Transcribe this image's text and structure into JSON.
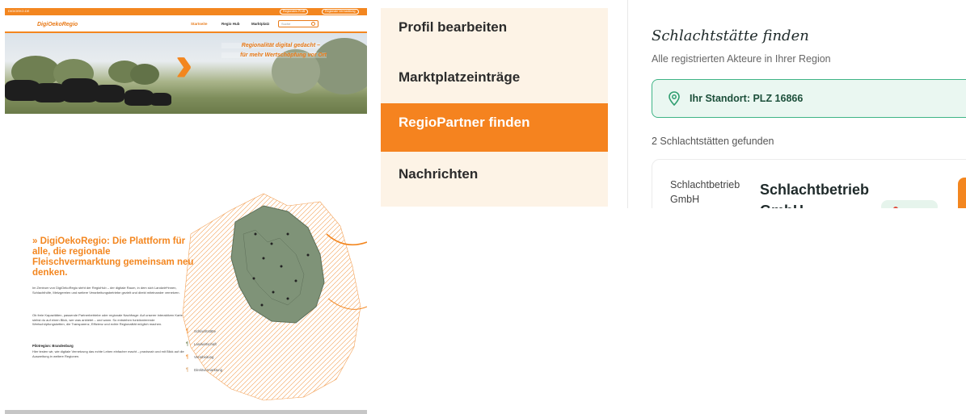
{
  "website": {
    "topbar": {
      "left_text": "DIGIOEKO.DE",
      "login_label": "Regionales Profil",
      "register_label": "Regionale Vermarktung"
    },
    "logo": "DigiOekoRegio",
    "nav": {
      "items": [
        "Startseite",
        "Regio Hub",
        "Marktplatz"
      ],
      "search_placeholder": "Suche"
    },
    "hero": {
      "slogan_line1": "Regionalität digital gedacht –",
      "slogan_line2": "für mehr Wertschöpfung vor Ort"
    },
    "intro": {
      "headline": "» DigiOekoRegio: Die Plattform für alle, die regionale Fleischvermarktung gemeinsam neu denken.",
      "paragraph1": "Im Zentrum von DigiOekoRegio steht der RegioHub – der digitale Raum, in dem sich Landwirt*innen, Schlachthöfe, Metzgereien und weitere Verarbeitungsbetriebe gezielt und direkt miteinander vernetzen.",
      "paragraph2": "Ob freie Kapazitäten, passende Partnerbetriebe oder regionale Nachfrage: Auf unserer interaktiven Karte siehst du auf einen Blick, wer was anbietet – und wann. So entstehen funktionierende Wertschöpfungsketten, die Transparenz, Effizienz und echte Regionalität möglich machen.",
      "pilot_title": "Pilotregion: Brandenburg",
      "pilot_text": "Hier testen wir, wie digitale Vernetzung das echte Leben einfacher macht – praxisnah und mit Blick auf die Ausweitung in weitere Regionen."
    },
    "map_legend": [
      "Schlachtstätte",
      "Landwirtschaft",
      "Verarbeitung",
      "Direktvermarktung"
    ],
    "colors": {
      "accent": "#f3861f",
      "map_region": "#7f9378"
    }
  },
  "menu": {
    "items": [
      "Profil bearbeiten",
      "Marktplatzeinträge",
      "RegioPartner finden",
      "Nachrichten"
    ],
    "active_index": 2
  },
  "finder": {
    "title": "Schlachtstätte finden",
    "subtitle": "Alle registrierten Akteure in Ihrer Region",
    "location_label": "Ihr Standort: PLZ 16866",
    "result_count": "2 Schlachtstätten gefunden",
    "card": {
      "image_alt": "Schlachtbetrieb GmbH",
      "name": "Schlachtbetrieb GmbH"
    },
    "colors": {
      "location_border": "#3fb486",
      "location_bg": "#eaf7f1",
      "menu_active": "#f5831f"
    }
  }
}
